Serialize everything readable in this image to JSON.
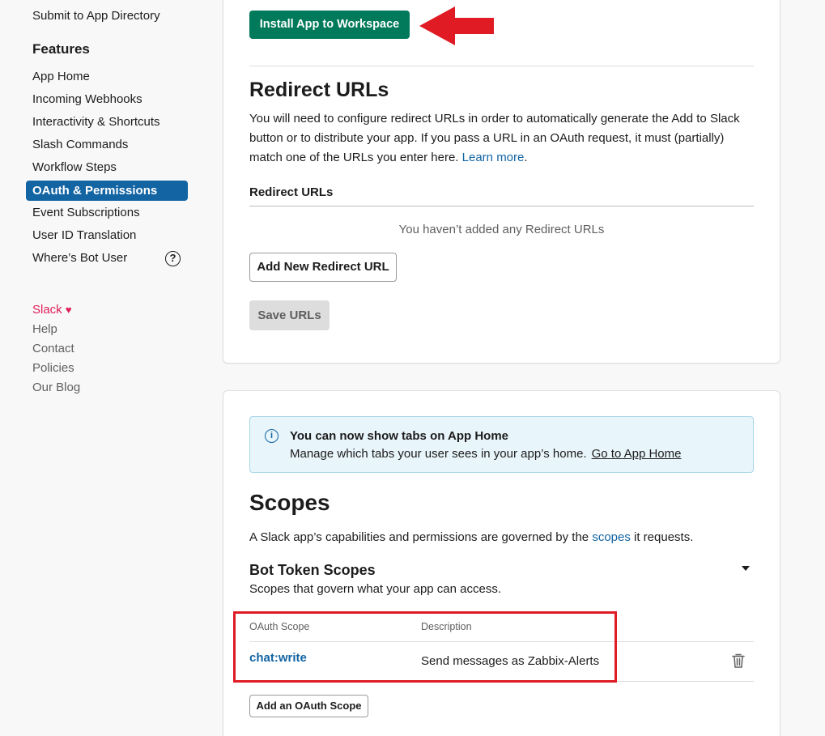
{
  "sidebar": {
    "top_link": "Submit to App Directory",
    "features_heading": "Features",
    "items": [
      {
        "label": "App Home"
      },
      {
        "label": "Incoming Webhooks"
      },
      {
        "label": "Interactivity & Shortcuts"
      },
      {
        "label": "Slash Commands"
      },
      {
        "label": "Workflow Steps"
      },
      {
        "label": "OAuth & Permissions",
        "active": true
      },
      {
        "label": "Event Subscriptions"
      },
      {
        "label": "User ID Translation"
      },
      {
        "label": "Where’s Bot User"
      }
    ],
    "help_icon_glyph": "?",
    "footer": {
      "slack_label": "Slack",
      "heart": "♥",
      "links": [
        "Help",
        "Contact",
        "Policies",
        "Our Blog"
      ]
    }
  },
  "install": {
    "button_label": "Install App to Workspace"
  },
  "redirect": {
    "title": "Redirect URLs",
    "description": "You will need to configure redirect URLs in order to automatically generate the Add to Slack button or to distribute your app. If you pass a URL in an OAuth request, it must (partially) match one of the URLs you enter here.",
    "learn_more": "Learn more",
    "period": ".",
    "list_label": "Redirect URLs",
    "empty_message": "You haven’t added any Redirect URLs",
    "add_button": "Add New Redirect URL",
    "save_button": "Save URLs"
  },
  "banner": {
    "info_glyph": "i",
    "title": "You can now show tabs on App Home",
    "text": "Manage which tabs your user sees in your app’s home.",
    "link": "Go to App Home"
  },
  "scopes": {
    "title": "Scopes",
    "description_prefix": "A Slack app’s capabilities and permissions are governed by the",
    "description_link": "scopes",
    "description_suffix": "it requests.",
    "bot_title": "Bot Token Scopes",
    "bot_subtitle": "Scopes that govern what your app can access.",
    "table": {
      "headers": [
        "OAuth Scope",
        "Description"
      ],
      "rows": [
        {
          "scope": "chat:write",
          "description": "Send messages as Zabbix-Alerts"
        }
      ]
    },
    "add_button": "Add an OAuth Scope"
  },
  "colors": {
    "install_green": "#007a5a",
    "link_blue": "#1264a3",
    "active_nav": "#1264a3",
    "annotation_red": "#e01b24"
  }
}
